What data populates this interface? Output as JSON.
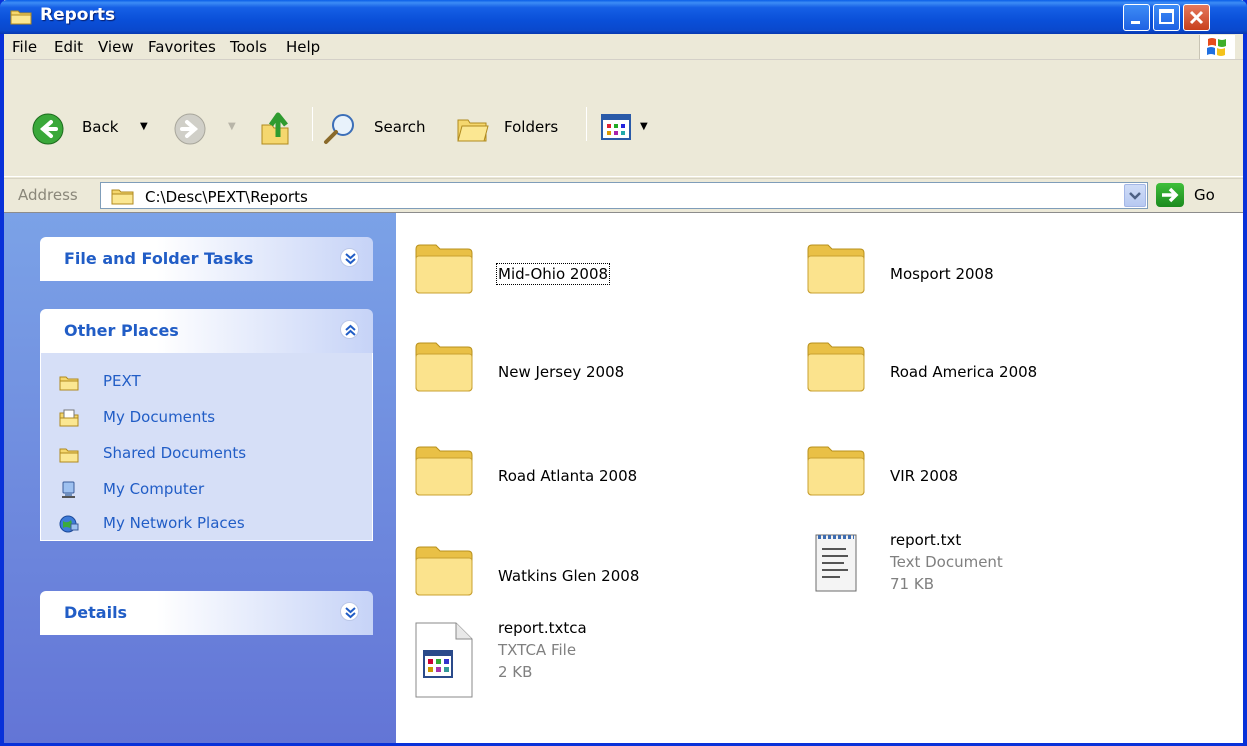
{
  "window": {
    "title": "Reports"
  },
  "menu": [
    "File",
    "Edit",
    "View",
    "Favorites",
    "Tools",
    "Help"
  ],
  "toolbar": {
    "back_label": "Back",
    "search_label": "Search",
    "folders_label": "Folders"
  },
  "address": {
    "label": "Address",
    "path": "C:\\Desc\\PEXT\\Reports",
    "go_label": "Go"
  },
  "sidebar": {
    "file_tasks": {
      "title": "File and Folder Tasks"
    },
    "other_places": {
      "title": "Other Places",
      "items": [
        {
          "label": "PEXT",
          "icon": "folder-icon"
        },
        {
          "label": "My Documents",
          "icon": "my-documents-icon"
        },
        {
          "label": "Shared Documents",
          "icon": "folder-icon"
        },
        {
          "label": "My Computer",
          "icon": "computer-icon"
        },
        {
          "label": "My Network Places",
          "icon": "network-icon"
        }
      ]
    },
    "details": {
      "title": "Details"
    }
  },
  "files": [
    {
      "name": "Mid-Ohio 2008",
      "type": "folder"
    },
    {
      "name": "Mosport 2008",
      "type": "folder"
    },
    {
      "name": "New Jersey 2008",
      "type": "folder"
    },
    {
      "name": "Road America 2008",
      "type": "folder"
    },
    {
      "name": "Road Atlanta 2008",
      "type": "folder"
    },
    {
      "name": "VIR 2008",
      "type": "folder"
    },
    {
      "name": "Watkins Glen 2008",
      "type": "folder"
    },
    {
      "name": "report.txt",
      "type": "Text Document",
      "size": "71 KB"
    },
    {
      "name": "report.txtca",
      "type": "TXTCA File",
      "size": "2 KB"
    }
  ]
}
